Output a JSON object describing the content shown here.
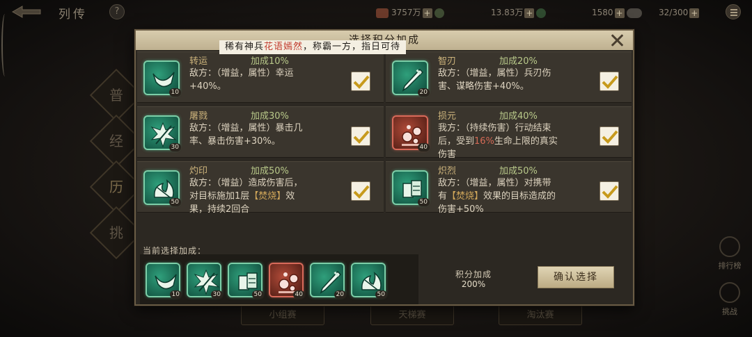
{
  "hud": {
    "title": "列传",
    "help": "?",
    "res1": "3757万",
    "res2": "13.83万",
    "res3": "1580",
    "res4": "32/300",
    "plus": "+"
  },
  "side": {
    "tabs": [
      "普",
      "经",
      "历",
      "挑"
    ],
    "right_items": [
      "排行榜",
      "挑战"
    ]
  },
  "bottom": [
    "小组赛",
    "天梯赛",
    "淘汰赛"
  ],
  "dialog": {
    "title": "选择积分加成",
    "banner_pre": "稀有神兵",
    "banner_hl": "花语嫣然",
    "banner_post": "，称霸一方，指日可待"
  },
  "cards": [
    {
      "name": "转运",
      "bonus": "加成10%",
      "line1": "敌方：（增益，属性）幸运",
      "line2": "+40%。",
      "line3": "",
      "level": "10",
      "icon": "horn-icon",
      "red": false
    },
    {
      "name": "智刃",
      "bonus": "加成20%",
      "line1": "敌方：（增益，属性）兵刃伤",
      "line2": "害、谋略伤害+40%。",
      "line3": "",
      "level": "20",
      "icon": "blade-icon",
      "red": false
    },
    {
      "name": "屠戮",
      "bonus": "加成30%",
      "line1": "敌方：（增益，属性）暴击几",
      "line2": "率、暴击伤害+30%。",
      "line3": "",
      "level": "30",
      "icon": "burst-icon",
      "red": false
    },
    {
      "name": "损元",
      "bonus": "加成40%",
      "line1": "我方：（持续伤害）行动结束",
      "line2a": "后，受到",
      "line2red": "16%",
      "line2b": "生命上限的真实",
      "line3": "伤害",
      "level": "40",
      "icon": "orbs-icon",
      "red": true
    },
    {
      "name": "灼印",
      "bonus": "加成50%",
      "line1": "敌方：（增益）造成伤害后，",
      "line2a": "对目标施加1层",
      "line2gold": "【焚烧】",
      "line2b": "效",
      "line3": "果，持续2回合",
      "level": "50",
      "icon": "flame-armor-icon",
      "red": false
    },
    {
      "name": "炽烈",
      "bonus": "加成50%",
      "line1": "敌方：（增益，属性）对携带",
      "line2a": "有",
      "line2gold": "【焚烧】",
      "line2b": "效果的目标造成的",
      "line3": "伤害+50%",
      "level": "50",
      "icon": "armor-icon",
      "red": false
    }
  ],
  "selected": {
    "label": "当前选择加成：",
    "items": [
      {
        "level": "10",
        "icon": "horn-icon",
        "red": false
      },
      {
        "level": "30",
        "icon": "burst-icon",
        "red": false
      },
      {
        "level": "50",
        "icon": "armor-icon",
        "red": false
      },
      {
        "level": "40",
        "icon": "orbs-icon",
        "red": true
      },
      {
        "level": "20",
        "icon": "blade-icon",
        "red": false
      },
      {
        "level": "50",
        "icon": "flame-armor-icon",
        "red": false
      }
    ]
  },
  "score": {
    "label": "积分加成",
    "value": "200%"
  },
  "confirm": "确认选择"
}
